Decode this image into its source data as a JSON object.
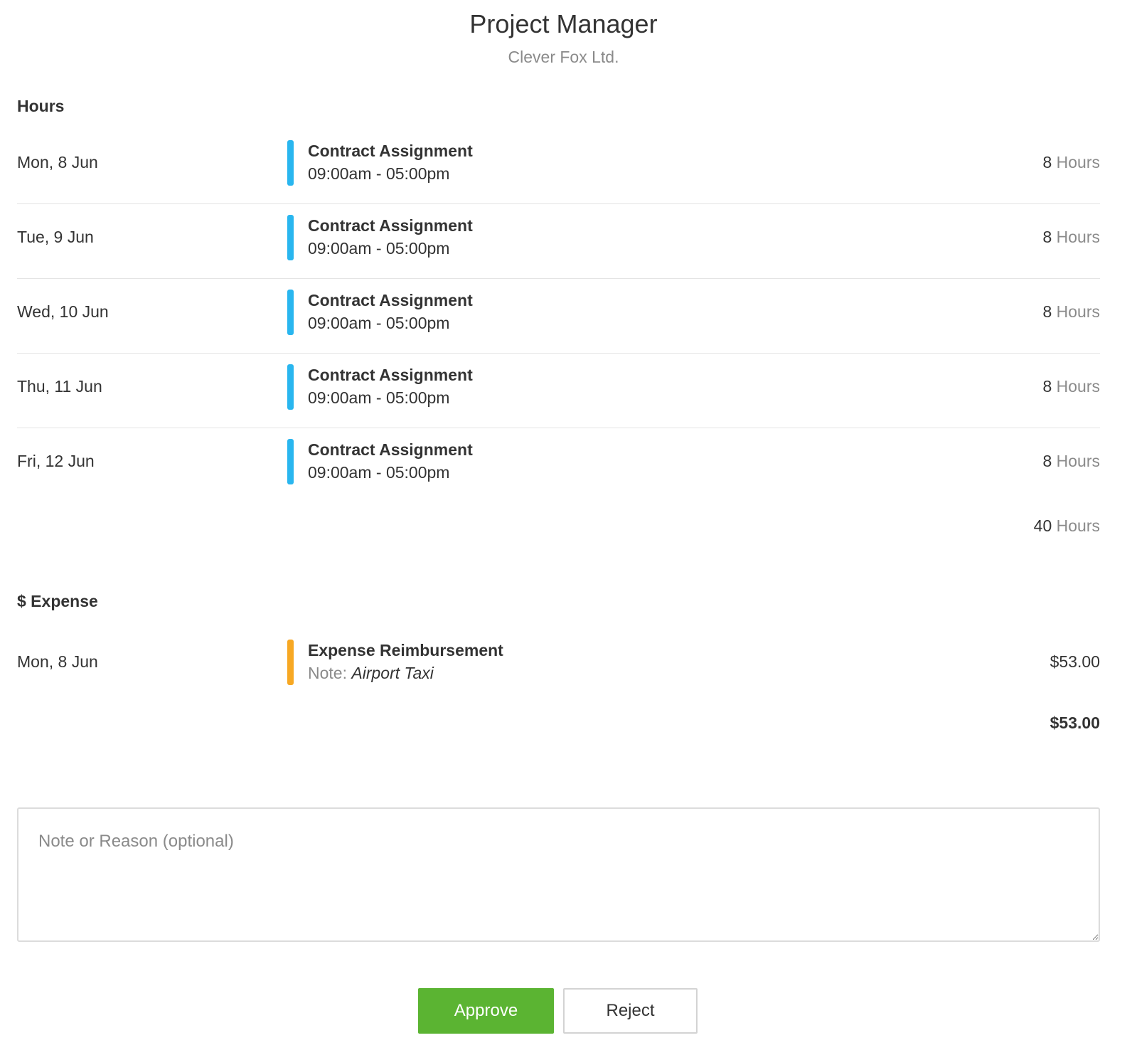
{
  "header": {
    "title": "Project Manager",
    "subtitle": "Clever Fox Ltd."
  },
  "hours": {
    "heading": "Hours",
    "entries": [
      {
        "date": "Mon, 8 Jun",
        "title": "Contract Assignment",
        "time": "09:00am - 05:00pm",
        "hours": "8",
        "unit": "Hours"
      },
      {
        "date": "Tue, 9 Jun",
        "title": "Contract Assignment",
        "time": "09:00am - 05:00pm",
        "hours": "8",
        "unit": "Hours"
      },
      {
        "date": "Wed, 10 Jun",
        "title": "Contract Assignment",
        "time": "09:00am - 05:00pm",
        "hours": "8",
        "unit": "Hours"
      },
      {
        "date": "Thu, 11 Jun",
        "title": "Contract Assignment",
        "time": "09:00am - 05:00pm",
        "hours": "8",
        "unit": "Hours"
      },
      {
        "date": "Fri, 12 Jun",
        "title": "Contract Assignment",
        "time": "09:00am - 05:00pm",
        "hours": "8",
        "unit": "Hours"
      }
    ],
    "total": "40",
    "total_unit": "Hours",
    "bar_color": "#29b6ef"
  },
  "expense": {
    "heading": "$ Expense",
    "entries": [
      {
        "date": "Mon, 8 Jun",
        "title": "Expense Reimbursement",
        "note_label": "Note:",
        "note": "Airport Taxi",
        "amount": "$53.00"
      }
    ],
    "total": "$53.00",
    "bar_color": "#f7a823"
  },
  "note_field": {
    "placeholder": "Note or Reason (optional)",
    "value": ""
  },
  "actions": {
    "approve_label": "Approve",
    "reject_label": "Reject",
    "approve_color": "#5bb432"
  }
}
